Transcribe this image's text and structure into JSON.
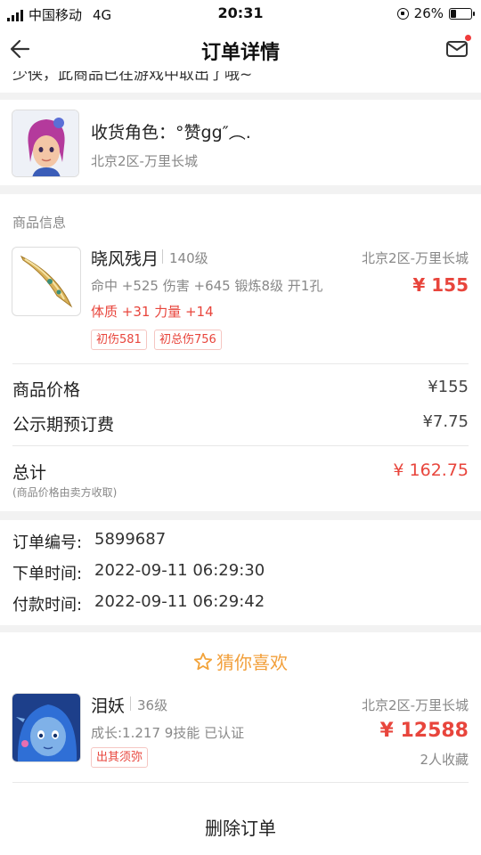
{
  "status_bar": {
    "carrier": "中国移动",
    "network": "4G",
    "time": "20:31",
    "battery": "26%",
    "battery_level": 0.26
  },
  "nav": {
    "title": "订单详情",
    "back_icon": "back-arrow-icon",
    "mail_icon": "mail-icon"
  },
  "notice": {
    "text": "少侠，此商品已在游戏中取出了哦~"
  },
  "receiver": {
    "label": "收货角色：",
    "name": "°赞gg″︵.",
    "server": "北京2区-万里长城"
  },
  "product_section": {
    "heading": "商品信息",
    "item": {
      "name": "晓风残月",
      "level": "140级",
      "server": "北京2区-万里长城",
      "stats_line": "命中 +525 伤害 +645 锻炼8级 开1孔",
      "attr_line": "体质 +31 力量 +14",
      "price": "¥ 155",
      "tags": [
        "初伤581",
        "初总伤756"
      ]
    }
  },
  "pricing": {
    "rows": [
      {
        "label": "商品价格",
        "value": "¥155"
      },
      {
        "label": "公示期预订费",
        "value": "¥7.75"
      }
    ],
    "total_label": "总计",
    "total_note": "(商品价格由卖方收取)",
    "total_value": "¥ 162.75"
  },
  "order_info": {
    "rows": [
      {
        "label": "订单编号:",
        "value": "5899687"
      },
      {
        "label": "下单时间:",
        "value": "2022-09-11 06:29:30"
      },
      {
        "label": "付款时间:",
        "value": "2022-09-11 06:29:42"
      }
    ]
  },
  "guess": {
    "title": "猜你喜欢",
    "item": {
      "name": "泪妖",
      "level": "36级",
      "server": "北京2区-万里长城",
      "detail": "成长:1.217 9技能 已认证",
      "tag": "出其须弥",
      "price": "¥ 12588",
      "favorites": "2人收藏"
    }
  },
  "actions": {
    "delete_label": "删除订单"
  },
  "colors": {
    "accent_red": "#e8453c",
    "guess_orange": "#f29f3a"
  }
}
